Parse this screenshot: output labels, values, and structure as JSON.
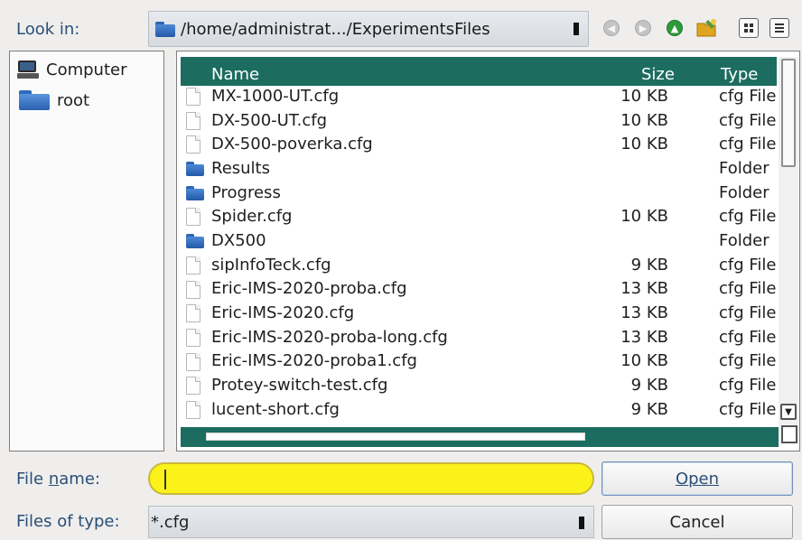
{
  "look_in": {
    "label": "Look in:",
    "path": "/home/administrat.../ExperimentsFiles"
  },
  "toolbar": {
    "icons": [
      "back-icon",
      "forward-icon",
      "parent-directory-icon",
      "new-folder-icon",
      "list-view-icon",
      "detail-view-icon"
    ]
  },
  "sidebar": {
    "items": [
      {
        "label": "Computer",
        "icon": "computer-icon"
      },
      {
        "label": "root",
        "icon": "folder-icon"
      }
    ]
  },
  "file_list": {
    "columns": {
      "name": "Name",
      "size": "Size",
      "type": "Type"
    },
    "rows": [
      {
        "name": "MX-1000-UT.cfg",
        "size": "10 KB",
        "type": "cfg File",
        "kind": "file"
      },
      {
        "name": "DX-500-UT.cfg",
        "size": "10 KB",
        "type": "cfg File",
        "kind": "file"
      },
      {
        "name": "DX-500-poverka.cfg",
        "size": "10 KB",
        "type": "cfg File",
        "kind": "file"
      },
      {
        "name": "Results",
        "size": "",
        "type": "Folder",
        "kind": "folder"
      },
      {
        "name": "Progress",
        "size": "",
        "type": "Folder",
        "kind": "folder"
      },
      {
        "name": "Spider.cfg",
        "size": "10 KB",
        "type": "cfg File",
        "kind": "file"
      },
      {
        "name": "DX500",
        "size": "",
        "type": "Folder",
        "kind": "folder"
      },
      {
        "name": "sipInfoTeck.cfg",
        "size": "9 KB",
        "type": "cfg File",
        "kind": "file"
      },
      {
        "name": "Eric-IMS-2020-proba.cfg",
        "size": "13 KB",
        "type": "cfg File",
        "kind": "file"
      },
      {
        "name": "Eric-IMS-2020.cfg",
        "size": "13 KB",
        "type": "cfg File",
        "kind": "file"
      },
      {
        "name": "Eric-IMS-2020-proba-long.cfg",
        "size": "13 KB",
        "type": "cfg File",
        "kind": "file"
      },
      {
        "name": "Eric-IMS-2020-proba1.cfg",
        "size": "10 KB",
        "type": "cfg File",
        "kind": "file"
      },
      {
        "name": "Protey-switch-test.cfg",
        "size": "9 KB",
        "type": "cfg File",
        "kind": "file"
      },
      {
        "name": "lucent-short.cfg",
        "size": "9 KB",
        "type": "cfg File",
        "kind": "file"
      }
    ]
  },
  "file_name": {
    "label_prefix": "File ",
    "label_underlined": "n",
    "label_suffix": "ame:",
    "value": "",
    "placeholder": ""
  },
  "files_of_type": {
    "label": "Files of type:",
    "value": "*.cfg"
  },
  "buttons": {
    "open_underlined": "O",
    "open_rest": "pen",
    "cancel": "Cancel"
  },
  "colors": {
    "header_bg": "#1c6d5f",
    "input_highlight": "#fbf21a",
    "label_blue": "#2a4f78"
  }
}
